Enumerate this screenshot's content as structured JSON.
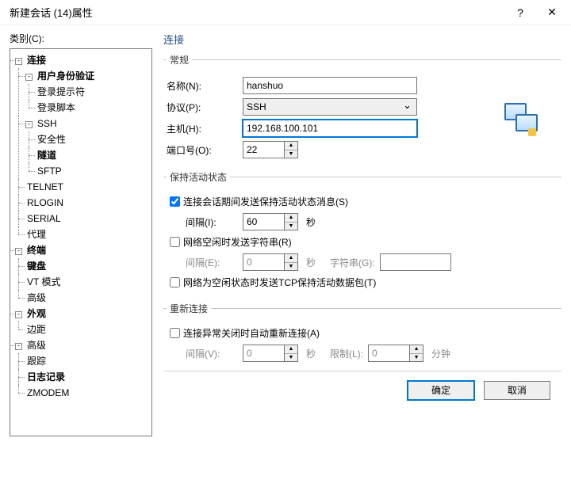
{
  "window": {
    "title": "新建会话 (14)属性",
    "help": "?",
    "close": "✕"
  },
  "categoryLabel": "类别(C):",
  "tree": {
    "connection": "连接",
    "userAuth": "用户身份验证",
    "loginPrompt": "登录提示符",
    "loginScript": "登录脚本",
    "ssh": "SSH",
    "security": "安全性",
    "tunnel": "隧道",
    "sftp": "SFTP",
    "telnet": "TELNET",
    "rlogin": "RLOGIN",
    "serial": "SERIAL",
    "proxy": "代理",
    "terminal": "终端",
    "keyboard": "键盘",
    "vtmode": "VT 模式",
    "advancedTerm": "高级",
    "appearance": "外观",
    "margin": "边距",
    "advanced": "高级",
    "trace": "跟踪",
    "logging": "日志记录",
    "zmodem": "ZMODEM"
  },
  "panel": {
    "heading": "连接",
    "general": {
      "legend": "常规",
      "nameLabel": "名称(N):",
      "name": "hanshuo",
      "protocolLabel": "协议(P):",
      "protocol": "SSH",
      "hostLabel": "主机(H):",
      "host": "192.168.100.101",
      "portLabel": "端口号(O):",
      "port": "22"
    },
    "keepalive": {
      "legend": "保持活动状态",
      "chk1": "连接会话期间发送保持活动状态消息(S)",
      "intervalI": "间隔(I):",
      "intervalIVal": "60",
      "sec": "秒",
      "chk2": "网络空闲时发送字符串(R)",
      "intervalE": "间隔(E):",
      "intervalEVal": "0",
      "stringLabel": "字符串(G):",
      "chk3": "网络为空闲状态时发送TCP保持活动数据包(T)"
    },
    "reconnect": {
      "legend": "重新连接",
      "chk": "连接异常关闭时自动重新连接(A)",
      "intervalV": "间隔(V):",
      "intervalVVal": "0",
      "limitLabel": "限制(L):",
      "limitVal": "0",
      "min": "分钟"
    }
  },
  "buttons": {
    "ok": "确定",
    "cancel": "取消"
  }
}
